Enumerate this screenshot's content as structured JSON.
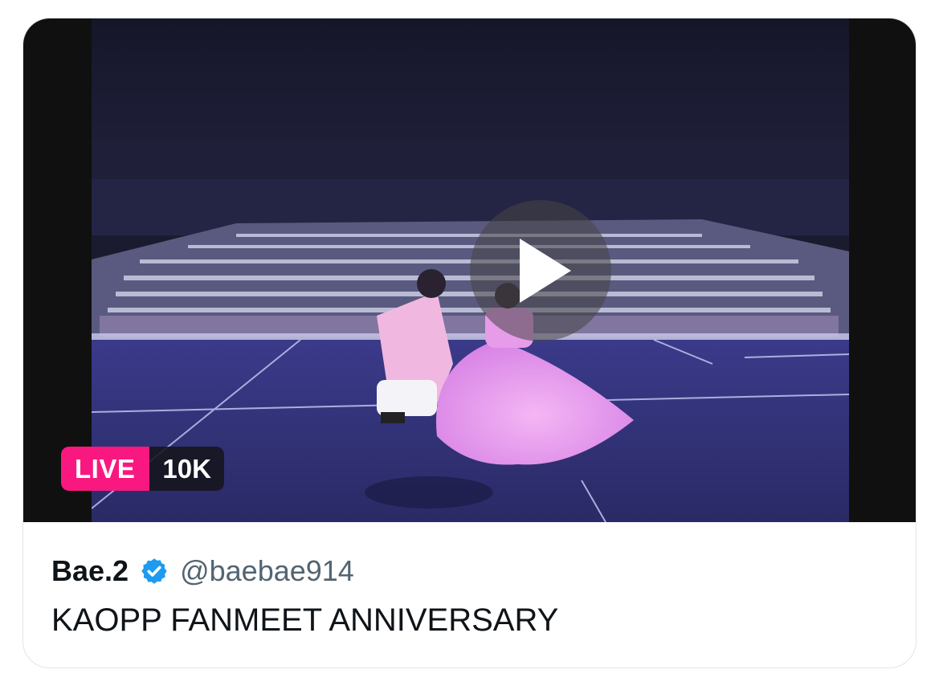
{
  "video": {
    "live_label": "LIVE",
    "viewer_count": "10K",
    "play_icon": "play-icon",
    "scene_icon": "concert-scene-thumbnail"
  },
  "author": {
    "display_name": "Bae.2",
    "verified_icon": "verified-badge-icon",
    "handle": "@baebae914"
  },
  "post": {
    "text": "KAOPP FANMEET ANNIVERSARY"
  },
  "colors": {
    "live_badge": "#f91880",
    "verified": "#1d9bf0",
    "handle": "#536471",
    "text": "#0f1419"
  }
}
